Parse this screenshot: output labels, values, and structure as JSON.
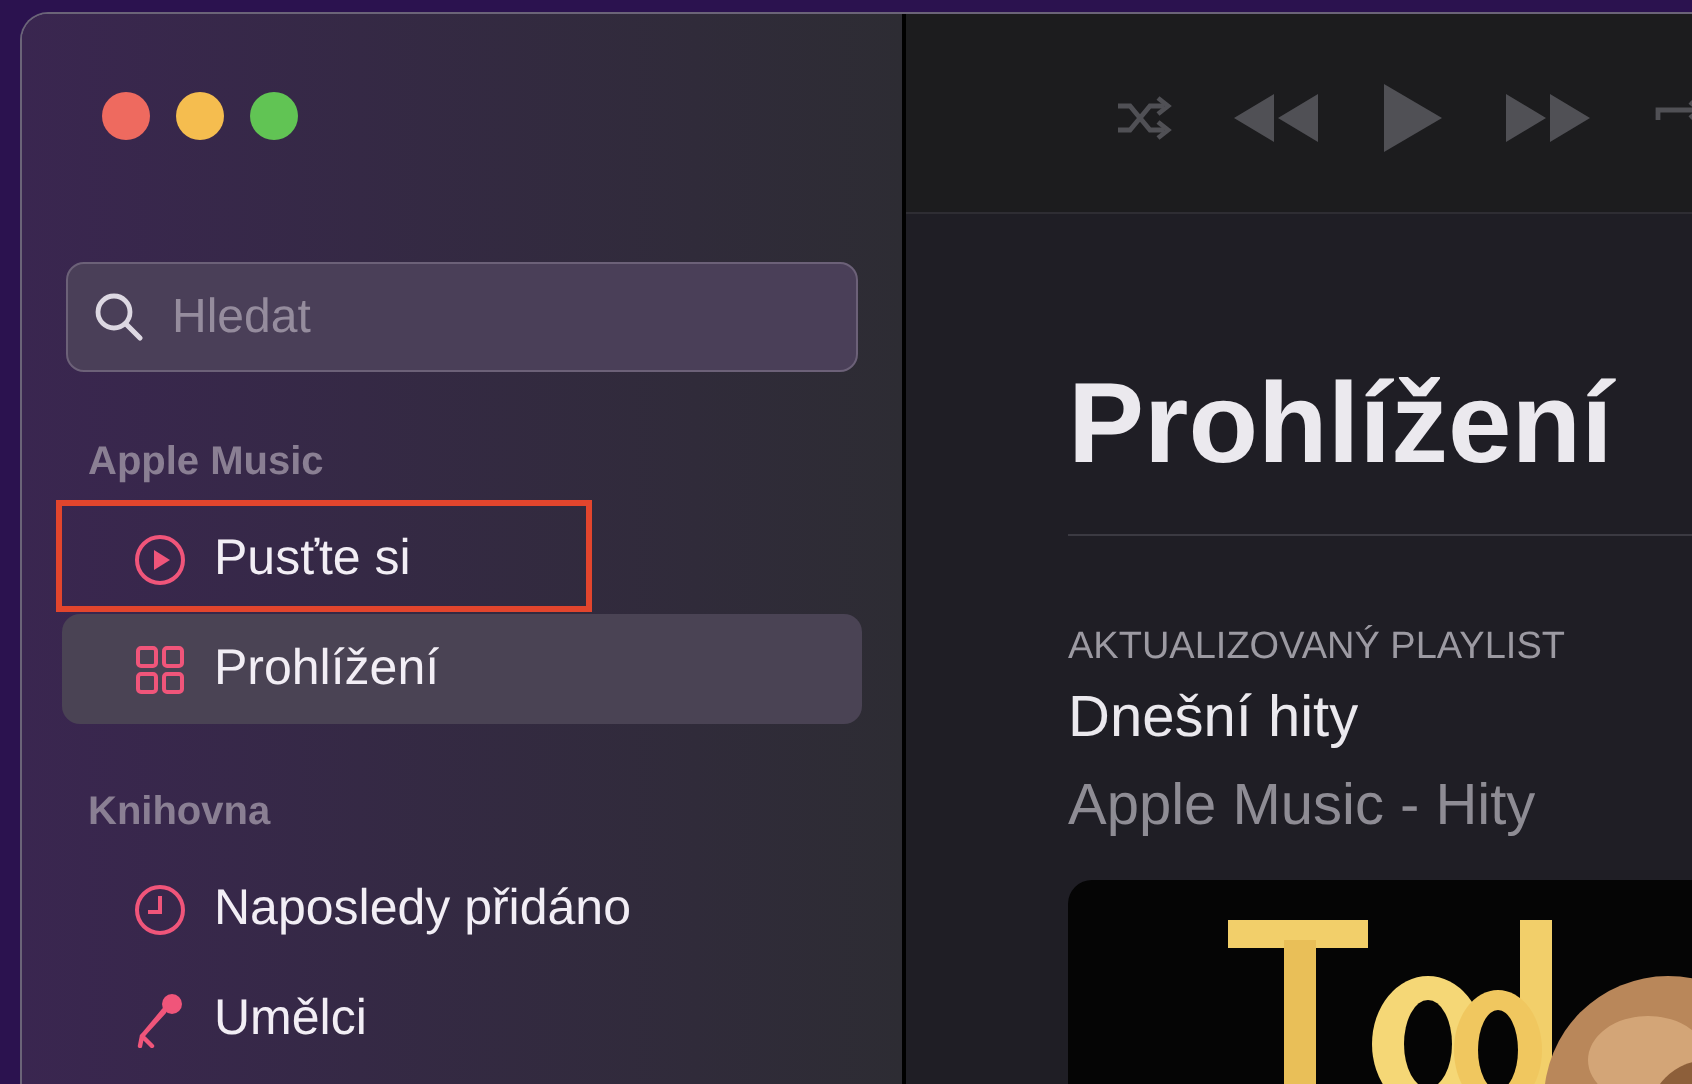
{
  "search": {
    "placeholder": "Hledat"
  },
  "sidebar": {
    "sections": [
      {
        "title": "Apple Music",
        "items": [
          {
            "label": "Pusťte si",
            "selected": false,
            "highlighted": true
          },
          {
            "label": "Prohlížení",
            "selected": true,
            "highlighted": false
          }
        ]
      },
      {
        "title": "Knihovna",
        "items": [
          {
            "label": "Naposledy přidáno",
            "selected": false,
            "highlighted": false
          },
          {
            "label": "Umělci",
            "selected": false,
            "highlighted": false
          }
        ]
      }
    ]
  },
  "content": {
    "heading": "Prohlížení",
    "eyebrow": "AKTUALIZOVANÝ PLAYLIST",
    "title": "Dnešní hity",
    "subtitle": "Apple Music - Hity"
  }
}
